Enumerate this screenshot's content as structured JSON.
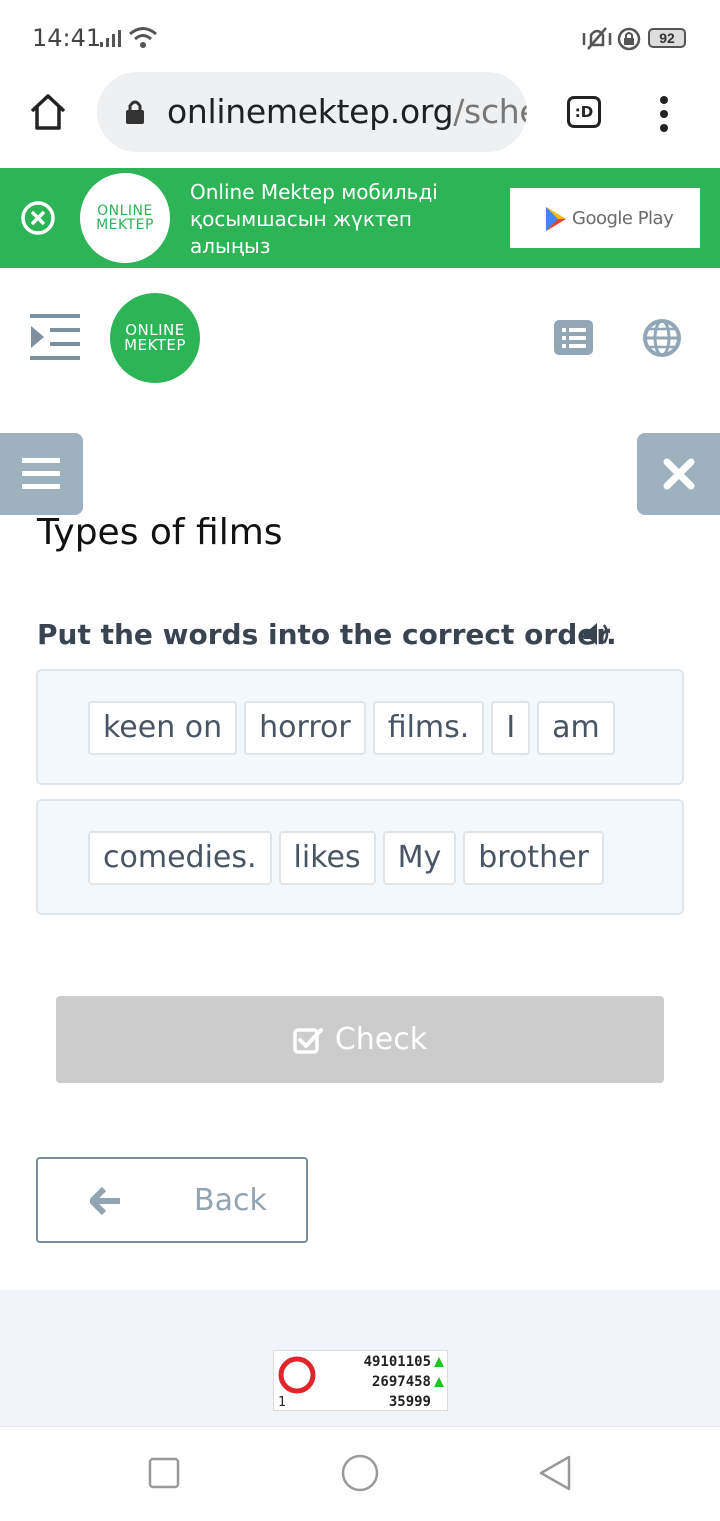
{
  "status_bar": {
    "time": "14:41",
    "battery": "92"
  },
  "browser": {
    "url_main": "onlinemektep.org",
    "url_rest": "/sched",
    "tab_label": ":D"
  },
  "promo": {
    "text": "Online Mektep мобильді қосымшасын жүктеп алыңыз",
    "logo_top": "ONLINE",
    "logo_bottom": "MEKTEP",
    "store_label": "Google Play"
  },
  "header": {
    "logo_top": "ONLINE",
    "logo_bottom": "MEKTEP"
  },
  "lesson": {
    "title": "Types of films",
    "instruction": "Put the words into the correct order.",
    "sentences": [
      {
        "words": [
          "keen on",
          "horror",
          "films.",
          "I",
          "am"
        ]
      },
      {
        "words": [
          "comedies.",
          "likes",
          "My",
          "brother"
        ]
      }
    ],
    "check_label": "Check",
    "back_label": "Back"
  },
  "counter": {
    "value1": "49101105",
    "value2": "2697458",
    "value3": "35999",
    "index": "1"
  },
  "colors": {
    "brand_green": "#2db457",
    "panel_gray": "#9db1be",
    "check_disabled": "#cccccc"
  }
}
